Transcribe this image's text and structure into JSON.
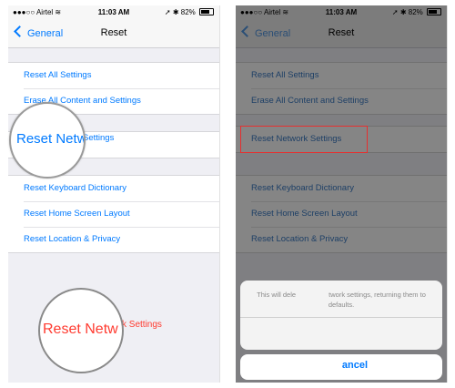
{
  "status_bar": {
    "carrier": "Airtel",
    "time": "11:03 AM",
    "battery": "82%"
  },
  "navbar": {
    "back_label": "General",
    "title": "Reset"
  },
  "left_screen": {
    "group1": [
      "Reset All Settings",
      "Erase All Content and Settings"
    ],
    "magnified_text": "Reset Netw",
    "magnified_rest": "Settings",
    "group3": [
      "Reset Keyboard Dictionary",
      "Reset Home Screen Layout",
      "Reset Location & Privacy"
    ]
  },
  "right_screen": {
    "group1": [
      "Reset All Settings",
      "Erase All Content and Settings"
    ],
    "highlighted_item": "Reset Network Settings",
    "group3": [
      "Reset Keyboard Dictionary",
      "Reset Home Screen Layout",
      "Reset Location & Privacy"
    ],
    "action_sheet": {
      "message_line1": "This will dele",
      "message_line1_end": "twork settings, returning them to",
      "message_line2": "defaults.",
      "magnified_text": "Reset Netw",
      "magnified_rest": "k Settings",
      "cancel_label": "ancel"
    }
  },
  "colors": {
    "ios_blue": "#007aff",
    "destructive_red": "#ff3b30",
    "highlight_box": "#e53030",
    "grouped_bg": "#efeff4"
  },
  "icons": [
    "chevron-left-icon",
    "bluetooth-icon",
    "location-arrow-icon",
    "battery-icon",
    "wifi-icon"
  ]
}
